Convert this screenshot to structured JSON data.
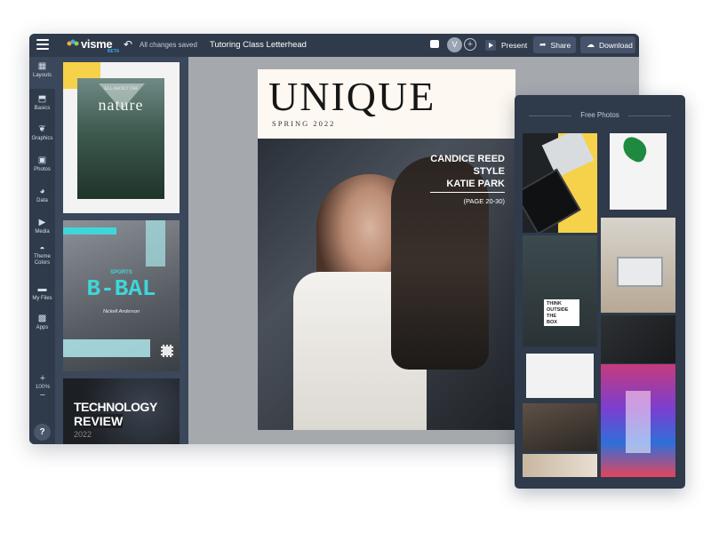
{
  "app": {
    "logo": "visme",
    "logo_badge": "BETA",
    "save_status": "All changes saved",
    "doc_title": "Tutoring Class Letterhead",
    "avatar_initial": "V",
    "present_label": "Present",
    "share_label": "Share",
    "download_label": "Download"
  },
  "toolbar": [
    {
      "label": "Layouts",
      "icon": "layouts-icon"
    },
    {
      "label": "Basics",
      "icon": "basics-icon"
    },
    {
      "label": "Graphics",
      "icon": "graphics-icon"
    },
    {
      "label": "Photos",
      "icon": "photos-icon"
    },
    {
      "label": "Data",
      "icon": "data-icon"
    },
    {
      "label": "Media",
      "icon": "media-icon"
    },
    {
      "label": "Theme Colors",
      "icon": "palette-icon"
    },
    {
      "label": "My Files",
      "icon": "folder-icon"
    },
    {
      "label": "Apps",
      "icon": "apps-icon"
    }
  ],
  "zoom": {
    "value": "100%"
  },
  "help_label": "?",
  "thumbnails": [
    {
      "title": "nature",
      "subtitle": "ALL ABOUT THE"
    },
    {
      "kicker": "SPORTS",
      "title": "B-BAL",
      "byline": "Nickell Anderson"
    },
    {
      "title_line1": "TECHNOLOGY",
      "title_line2": "REVIEW",
      "year": "2022"
    }
  ],
  "magazine": {
    "masthead": "UNIQUE",
    "issue": "SPRING 2022",
    "cover_lines": [
      "CANDICE REED",
      "STYLE",
      "KATIE PARK"
    ],
    "page_ref": "(PAGE 20-30)"
  },
  "photos_panel": {
    "title": "Free Photos",
    "lightbox_text": [
      "THINK",
      "OUTSIDE",
      "THE",
      "BOX"
    ]
  },
  "colors": {
    "chrome": "#2f3a4b",
    "accent_yellow": "#f6d24a",
    "accent_cyan": "#3fd6d9"
  }
}
